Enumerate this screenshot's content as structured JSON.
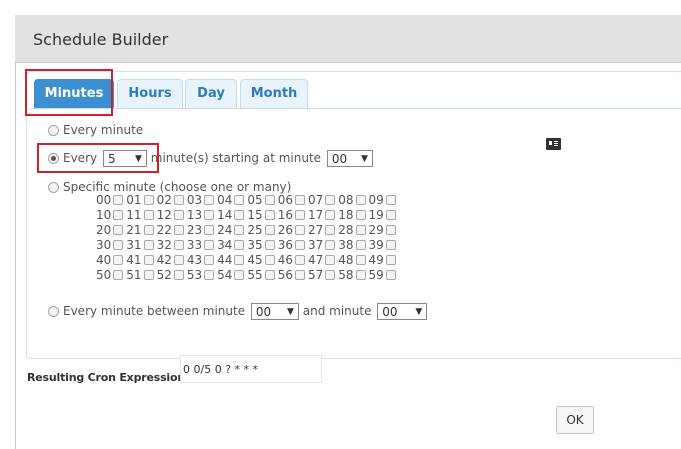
{
  "dialog": {
    "title": "Schedule Builder"
  },
  "tabs": [
    {
      "label": "Minutes",
      "active": true
    },
    {
      "label": "Hours",
      "active": false
    },
    {
      "label": "Day",
      "active": false
    },
    {
      "label": "Month",
      "active": false
    }
  ],
  "minutes": {
    "every_minute_label": "Every minute",
    "every_label": "Every",
    "every_value": "5",
    "starting_label": "minute(s) starting at minute",
    "starting_value": "00",
    "specific_label": "Specific minute (choose one or many)",
    "specific_minutes": [
      [
        "00",
        "01",
        "02",
        "03",
        "04",
        "05",
        "06",
        "07",
        "08",
        "09"
      ],
      [
        "10",
        "11",
        "12",
        "13",
        "14",
        "15",
        "16",
        "17",
        "18",
        "19"
      ],
      [
        "20",
        "21",
        "22",
        "23",
        "24",
        "25",
        "26",
        "27",
        "28",
        "29"
      ],
      [
        "30",
        "31",
        "32",
        "33",
        "34",
        "35",
        "36",
        "37",
        "38",
        "39"
      ],
      [
        "40",
        "41",
        "42",
        "43",
        "44",
        "45",
        "46",
        "47",
        "48",
        "49"
      ],
      [
        "50",
        "51",
        "52",
        "53",
        "54",
        "55",
        "56",
        "57",
        "58",
        "59"
      ]
    ],
    "between_label": "Every minute between minute",
    "between_from": "00",
    "and_label": "and minute",
    "between_to": "00",
    "selected_option": "every"
  },
  "result": {
    "label": "Resulting Cron Expression:",
    "value": "0 0/5 0 ? * * *"
  },
  "ok_label": "OK",
  "colors": {
    "active_tab": "#3c8fd0",
    "tab_text": "#2c7bc0",
    "highlight": "#d0222a"
  }
}
